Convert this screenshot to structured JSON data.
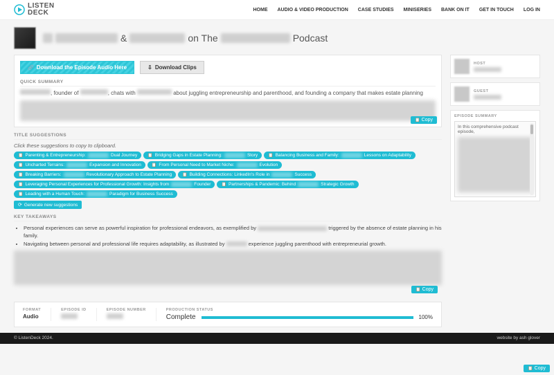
{
  "nav": {
    "home": "HOME",
    "avp": "AUDIO & VIDEO PRODUCTION",
    "cs": "CASE STUDIES",
    "mini": "MINISERIES",
    "bank": "BANK ON IT",
    "contact": "GET IN TOUCH",
    "login": "LOG IN"
  },
  "logo": {
    "text1": "LISTEN",
    "text2": "DECK"
  },
  "title": {
    "amp": "&",
    "on": "on The",
    "tail": "Podcast"
  },
  "buttons": {
    "download_episode": "Download the Episode Audio Here",
    "download_clips": "Download Clips"
  },
  "sections": {
    "quick_summary": "QUICK SUMMARY",
    "title_suggestions": "TITLE SUGGESTIONS",
    "title_hint": "Click these suggestions to copy to clipboard.",
    "key_takeaways": "KEY TAKEAWAYS",
    "episode_summary": "EPISODE SUMMARY"
  },
  "summary": {
    "p1a": ", founder of",
    "p1b": ", chats with",
    "p1c": "about juggling entrepreneurship and parenthood, and founding a company that makes estate planning"
  },
  "tags": [
    {
      "pre": "Parenting & Entrepreneurship:",
      "post": "Dual Journey"
    },
    {
      "pre": "Bridging Gaps in Estate Planning:",
      "post": "Story"
    },
    {
      "pre": "Balancing Business and Family:",
      "post": "Lessons on Adaptability"
    },
    {
      "pre": "Uncharted Terrains:",
      "post": "Expansion and Innovation"
    },
    {
      "pre": "From Personal Need to Market Niche:",
      "post": "Evolution"
    },
    {
      "pre": "Breaking Barriers:",
      "post": "Revolutionary Approach to Estate Planning"
    },
    {
      "pre": "Building Connections: LinkedIn's Role in",
      "post": "Success"
    },
    {
      "pre": "Leveraging Personal Experiences for Professional Growth: Insights from",
      "post": "Founder"
    },
    {
      "pre": "Partnerships & Pandemic: Behind",
      "post": "Strategic Growth"
    },
    {
      "pre": "Leading with a Human Touch:",
      "post": "Paradigm for Business Success"
    }
  ],
  "generate_btn": "Generate new suggestions",
  "takeaways": {
    "t1a": "Personal experiences can serve as powerful inspiration for professional endeavors, as exemplified by",
    "t1b": "triggered by the absence of estate planning in his family.",
    "t2a": "Navigating between personal and professional life requires adaptability, as illustrated by",
    "t2b": "experience juggling parenthood with entrepreneurial growth."
  },
  "copy_label": "Copy",
  "footer": {
    "format_l": "FORMAT",
    "format_v": "Audio",
    "epid_l": "EPISODE ID",
    "epnum_l": "EPISODE NUMBER",
    "prod_l": "PRODUCTION STATUS",
    "prod_v": "Complete",
    "prod_pct": "100%"
  },
  "side": {
    "host": "HOST",
    "guest": "GUEST"
  },
  "ep_box_intro": "In this comprehensive podcast episode,",
  "bottom": {
    "copy": "© ListenDeck 2024.",
    "credit": "website by ash glover"
  }
}
